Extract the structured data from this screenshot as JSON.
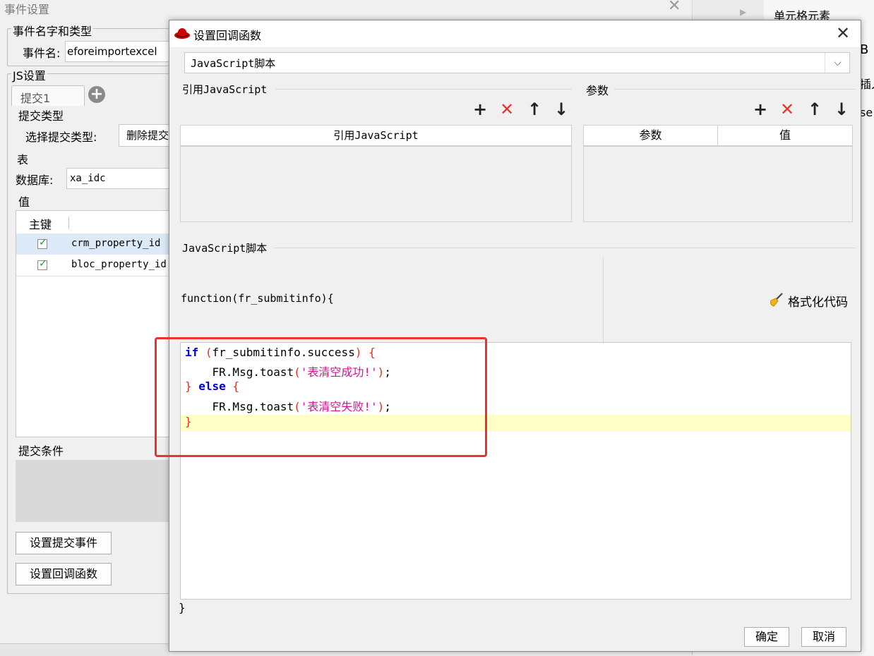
{
  "bg_dialog": {
    "title": "事件设置",
    "group_event": "事件名字和类型",
    "event_name_label": "事件名:",
    "event_name_value": "eforeimportexcel",
    "group_js": "JS设置",
    "tab_label": "提交1",
    "submit_type_header": "提交类型",
    "select_submit_type_label": "选择提交类型:",
    "select_submit_type_value": "删除提交",
    "table_header": "表",
    "database_label": "数据库:",
    "database_value": "xa_idc",
    "value_header": "值",
    "col_primary_key": "主键",
    "rows": [
      {
        "checked": true,
        "name": "crm_property_id"
      },
      {
        "checked": true,
        "name": "bloc_property_id"
      }
    ],
    "submit_condition": "提交条件",
    "btn_set_submit_event": "设置提交事件",
    "btn_set_callback": "设置回调函数"
  },
  "right_panel": {
    "cell_element": "单元格元素",
    "partial_1": "B",
    "partial_2": "插入",
    "partial_3": "se"
  },
  "dialog": {
    "title": "设置回调函数",
    "script_type_select": "JavaScript脚本",
    "ref_js_group": "引用JavaScript",
    "params_group": "参数",
    "ref_js_col": "引用JavaScript",
    "param_col": "参数",
    "value_col": "值",
    "script_group": "JavaScript脚本",
    "function_header": "function(fr_submitinfo){",
    "format_code": "格式化代码",
    "closing_brace": "}",
    "ok": "确定",
    "cancel": "取消",
    "toolbar": {
      "add": "+",
      "delete": "✕",
      "up": "↑",
      "down": "↓"
    }
  },
  "code": {
    "l1_kw": "if",
    "l1_open": " (",
    "l1_body": "fr_submitinfo.success",
    "l1_close": ") {",
    "l2_pre": "    FR.Msg.toast",
    "l2_open": "(",
    "l2_str": "'表清空成功!'",
    "l2_close": ")",
    "l2_end": ";",
    "l3_close": "} ",
    "l3_kw": "else",
    "l3_open": " {",
    "l4_pre": "    FR.Msg.toast",
    "l4_open": "(",
    "l4_str": "'表清空失败!'",
    "l4_close": ")",
    "l4_end": ";",
    "l5": "}"
  },
  "colors": {
    "highlight_box": "#e8342c",
    "current_line": "#ffffc8",
    "keyword": "#0000e0",
    "string": "#d6138f"
  }
}
